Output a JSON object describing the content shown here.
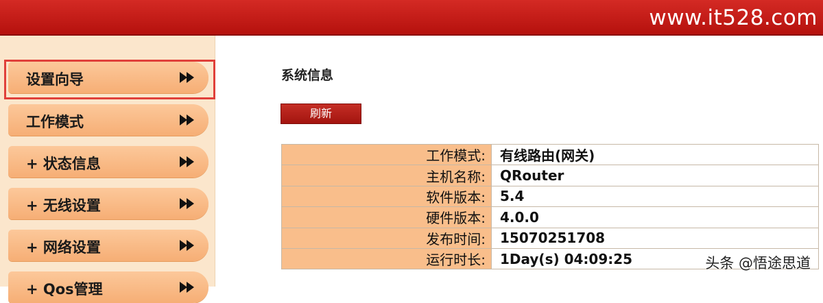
{
  "header": {
    "site_url": "www.it528.com"
  },
  "sidebar": {
    "items": [
      {
        "label": "设置向导"
      },
      {
        "label": "工作模式"
      },
      {
        "label": "+ 状态信息"
      },
      {
        "label": "+ 无线设置"
      },
      {
        "label": "+ 网络设置"
      },
      {
        "label": "+ Qos管理"
      }
    ],
    "selected_item": "设置向导"
  },
  "main": {
    "title": "系统信息",
    "refresh_label": "刷新",
    "info_rows": [
      {
        "key": "工作模式:",
        "value": "有线路由(网关)"
      },
      {
        "key": "主机名称:",
        "value": "QRouter"
      },
      {
        "key": "软件版本:",
        "value": "5.4"
      },
      {
        "key": "硬件版本:",
        "value": "4.0.0"
      },
      {
        "key": "发布时间:",
        "value": "15070251708"
      },
      {
        "key": "运行时长:",
        "value": "1Day(s) 04:09:25"
      }
    ]
  },
  "watermark": "头条 @悟途思道",
  "colors": {
    "header_red": "#c01b16",
    "sidebar_bg": "#fbe6cc",
    "nav_orange": "#f8b985",
    "highlight_border": "#e0403a",
    "table_key_bg": "#f9be8b"
  }
}
